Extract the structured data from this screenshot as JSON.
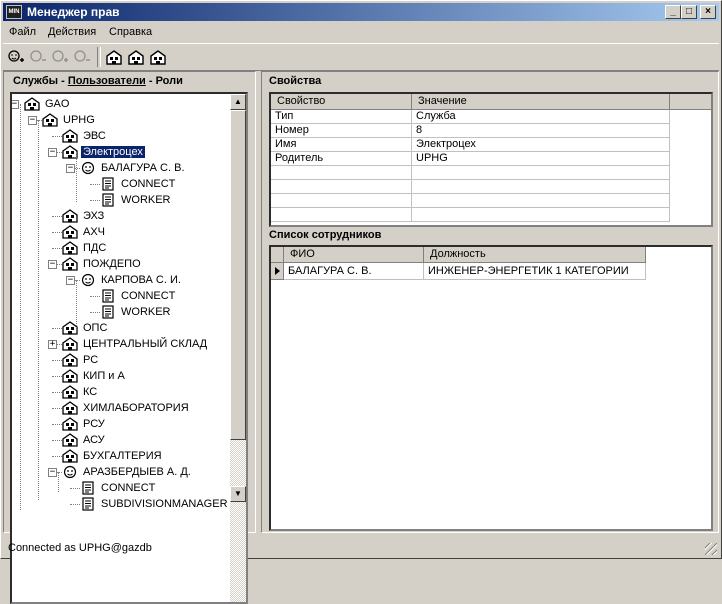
{
  "window": {
    "title": "Менеджер прав",
    "icon": "app-icon",
    "minimize": "_",
    "maximize": "□",
    "close": "×"
  },
  "menu": {
    "file": "Файл",
    "actions": "Действия",
    "help": "Справка"
  },
  "toolbar": {
    "icons": [
      "add-user-icon",
      "remove-user-icon",
      "add-role-icon",
      "remove-role-icon",
      "building-icon",
      "building-add-icon",
      "building-edit-icon"
    ]
  },
  "left": {
    "header_p1": "Службы",
    "header_sep1": " - ",
    "header_p2": "Пользователи",
    "header_sep2": " - ",
    "header_p3": "Роли",
    "tree": [
      {
        "label": "GAO"
      },
      {
        "label": "UPHG"
      },
      {
        "label": "ЭВС"
      },
      {
        "label": "Электроцех"
      },
      {
        "label": "БАЛАГУРА С. В."
      },
      {
        "label": "CONNECT"
      },
      {
        "label": "WORKER"
      },
      {
        "label": "ЭХЗ"
      },
      {
        "label": "АХЧ"
      },
      {
        "label": "ПДС"
      },
      {
        "label": "ПОЖДЕПО"
      },
      {
        "label": "КАРПОВА С. И."
      },
      {
        "label": "CONNECT"
      },
      {
        "label": "WORKER"
      },
      {
        "label": "ОПС"
      },
      {
        "label": "ЦЕНТРАЛЬНЫЙ СКЛАД"
      },
      {
        "label": "РС"
      },
      {
        "label": "КИП и А"
      },
      {
        "label": "КС"
      },
      {
        "label": "ХИМЛАБОРАТОРИЯ"
      },
      {
        "label": "РСУ"
      },
      {
        "label": "АСУ"
      },
      {
        "label": "БУХГАЛТЕРИЯ"
      },
      {
        "label": "АРАЗБЕРДЫЕВ А. Д."
      },
      {
        "label": "CONNECT"
      },
      {
        "label": "SUBDIVISIONMANAGER"
      }
    ]
  },
  "properties": {
    "header": "Свойства",
    "col_property": "Свойство",
    "col_value": "Значение",
    "rows": [
      {
        "name": "Тип",
        "value": "Служба"
      },
      {
        "name": "Номер",
        "value": "8"
      },
      {
        "name": "Имя",
        "value": "Электроцех"
      },
      {
        "name": "Родитель",
        "value": "UPHG"
      }
    ]
  },
  "employees": {
    "header": "Список сотрудников",
    "col_fio": "ФИО",
    "col_position": "Должность",
    "rows": [
      {
        "fio": "БАЛАГУРА С. В.",
        "position": "ИНЖЕНЕР-ЭНЕРГЕТИК 1 КАТЕГОРИИ"
      }
    ]
  },
  "status": {
    "text": "Connected as UPHG@gazdb"
  }
}
